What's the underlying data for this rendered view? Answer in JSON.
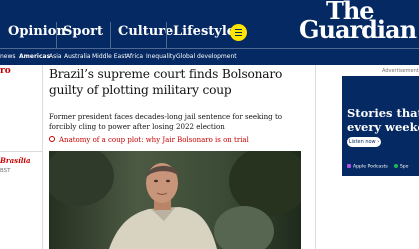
{
  "header": {
    "nav": [
      {
        "label": "Opinion"
      },
      {
        "label": "Sport"
      },
      {
        "label": "Culture"
      },
      {
        "label": "Lifestyle"
      }
    ],
    "logo_line1": "The",
    "logo_line2": "Guardian",
    "brand_color": "#052962",
    "menu_color": "#ffe500"
  },
  "subnav": {
    "items": [
      {
        "label": "news"
      },
      {
        "label": "Americas"
      },
      {
        "label": "Asia"
      },
      {
        "label": "Australia"
      },
      {
        "label": "Middle East"
      },
      {
        "label": "Africa"
      },
      {
        "label": "Inequality"
      },
      {
        "label": "Global development"
      }
    ],
    "active": "Americas"
  },
  "left": {
    "section_fragment": "ro",
    "dateline_place": "Brasília",
    "dateline_time": "BST"
  },
  "article": {
    "headline": "Brazil’s supreme court finds Bolsonaro guilty of plotting military coup",
    "standfirst": "Former president faces decades-long jail sentence for seeking to forcibly cling to power after losing 2022 election",
    "related_link": "Anatomy of a coup plot: why Jair Bolsonaro is on trial",
    "accent_color": "#c70000"
  },
  "ad": {
    "label": "Advertisement",
    "title_line1": "Stories that m",
    "title_line2": "every weekda",
    "listen_button": "Listen now ›",
    "platforms": [
      {
        "label": "Apple Podcasts",
        "color": "#b150e2"
      },
      {
        "label": "Spo",
        "color": "#1db954"
      }
    ]
  }
}
